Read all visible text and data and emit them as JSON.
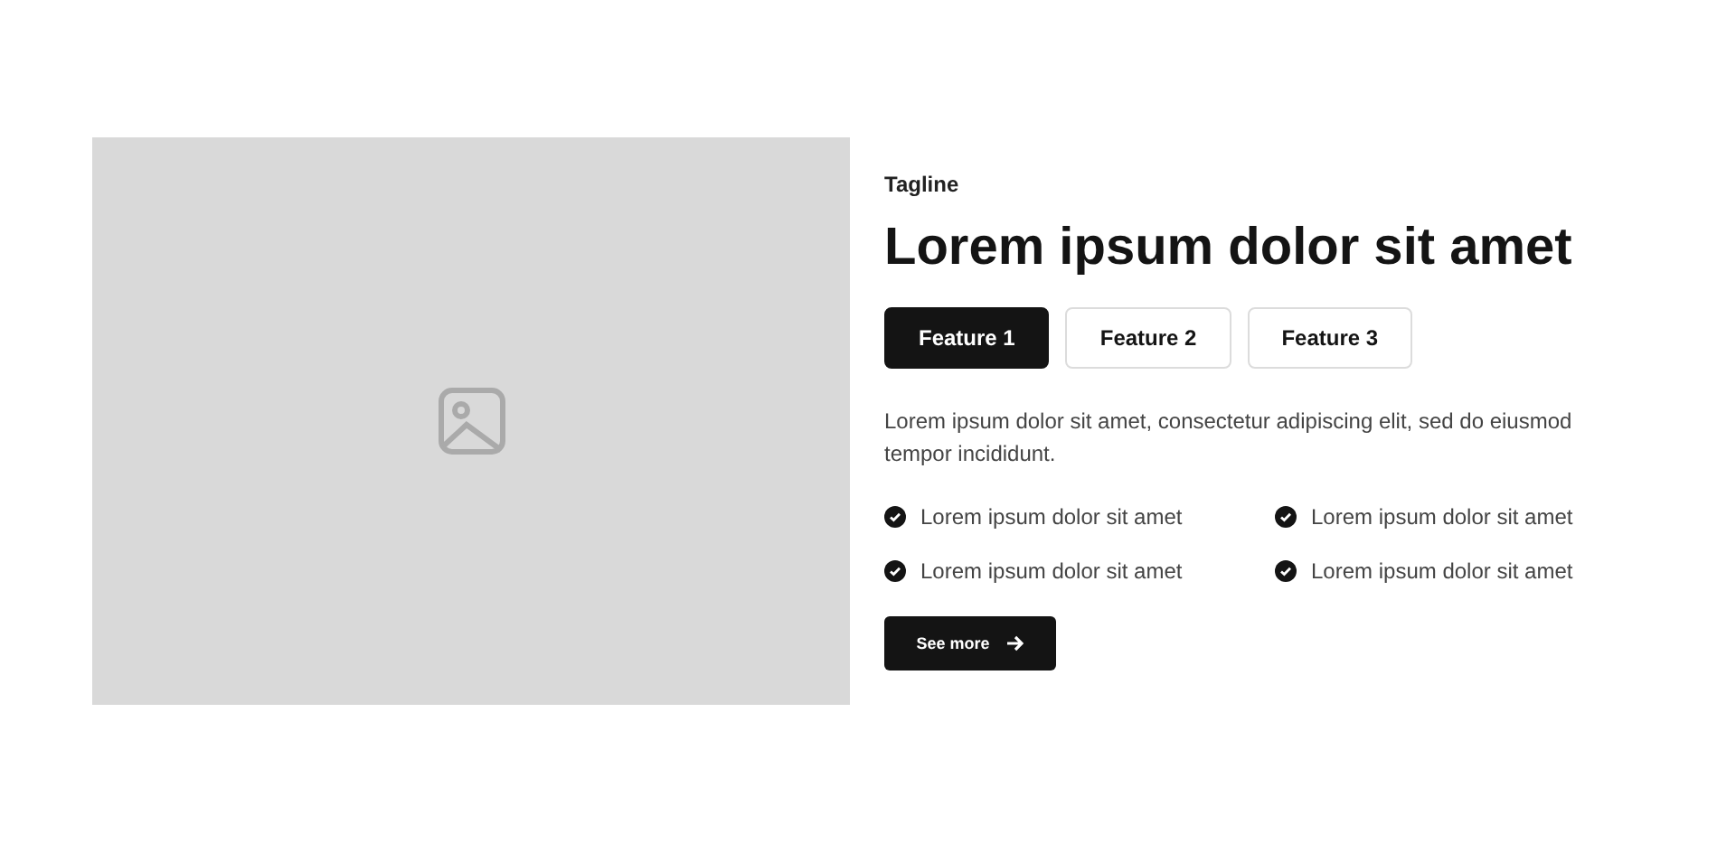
{
  "tagline": "Tagline",
  "heading": "Lorem ipsum dolor sit amet",
  "tabs": [
    {
      "label": "Feature 1",
      "selected": true
    },
    {
      "label": "Feature 2",
      "selected": false
    },
    {
      "label": "Feature 3",
      "selected": false
    }
  ],
  "description": "Lorem ipsum dolor sit amet, consectetur adipiscing elit, sed do eiusmod tempor incididunt.",
  "features": [
    "Lorem ipsum dolor sit amet",
    "Lorem ipsum dolor sit amet",
    "Lorem ipsum dolor sit amet",
    "Lorem ipsum dolor sit amet"
  ],
  "button": "See more"
}
